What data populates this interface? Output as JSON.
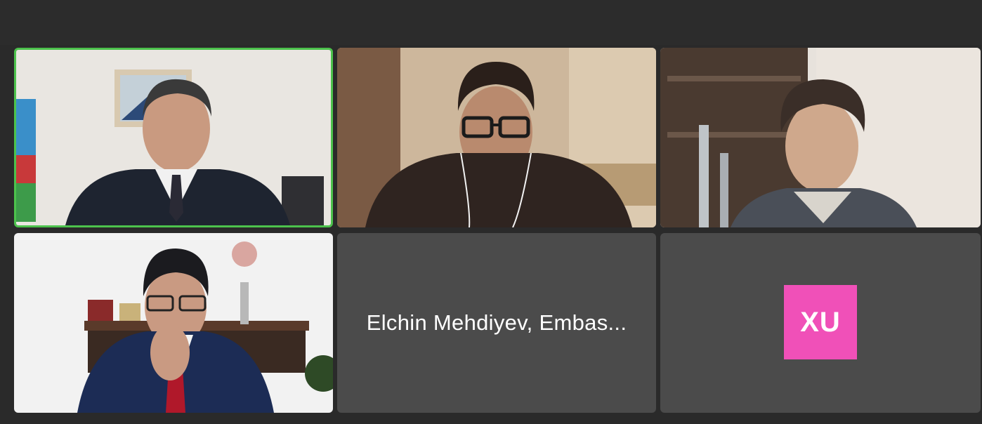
{
  "meeting": {
    "participants": [
      {
        "id": "p1",
        "video": "on",
        "speaking": true
      },
      {
        "id": "p2",
        "video": "on",
        "speaking": false
      },
      {
        "id": "p3",
        "video": "on",
        "speaking": false
      },
      {
        "id": "p4",
        "video": "on",
        "speaking": false
      },
      {
        "id": "p5",
        "video": "off",
        "display_name": "Elchin Mehdiyev, Embas..."
      },
      {
        "id": "p6",
        "video": "off",
        "avatar_initials": "XU",
        "avatar_color": "#f050b8"
      }
    ],
    "active_speaker_color": "#4cc24c"
  }
}
